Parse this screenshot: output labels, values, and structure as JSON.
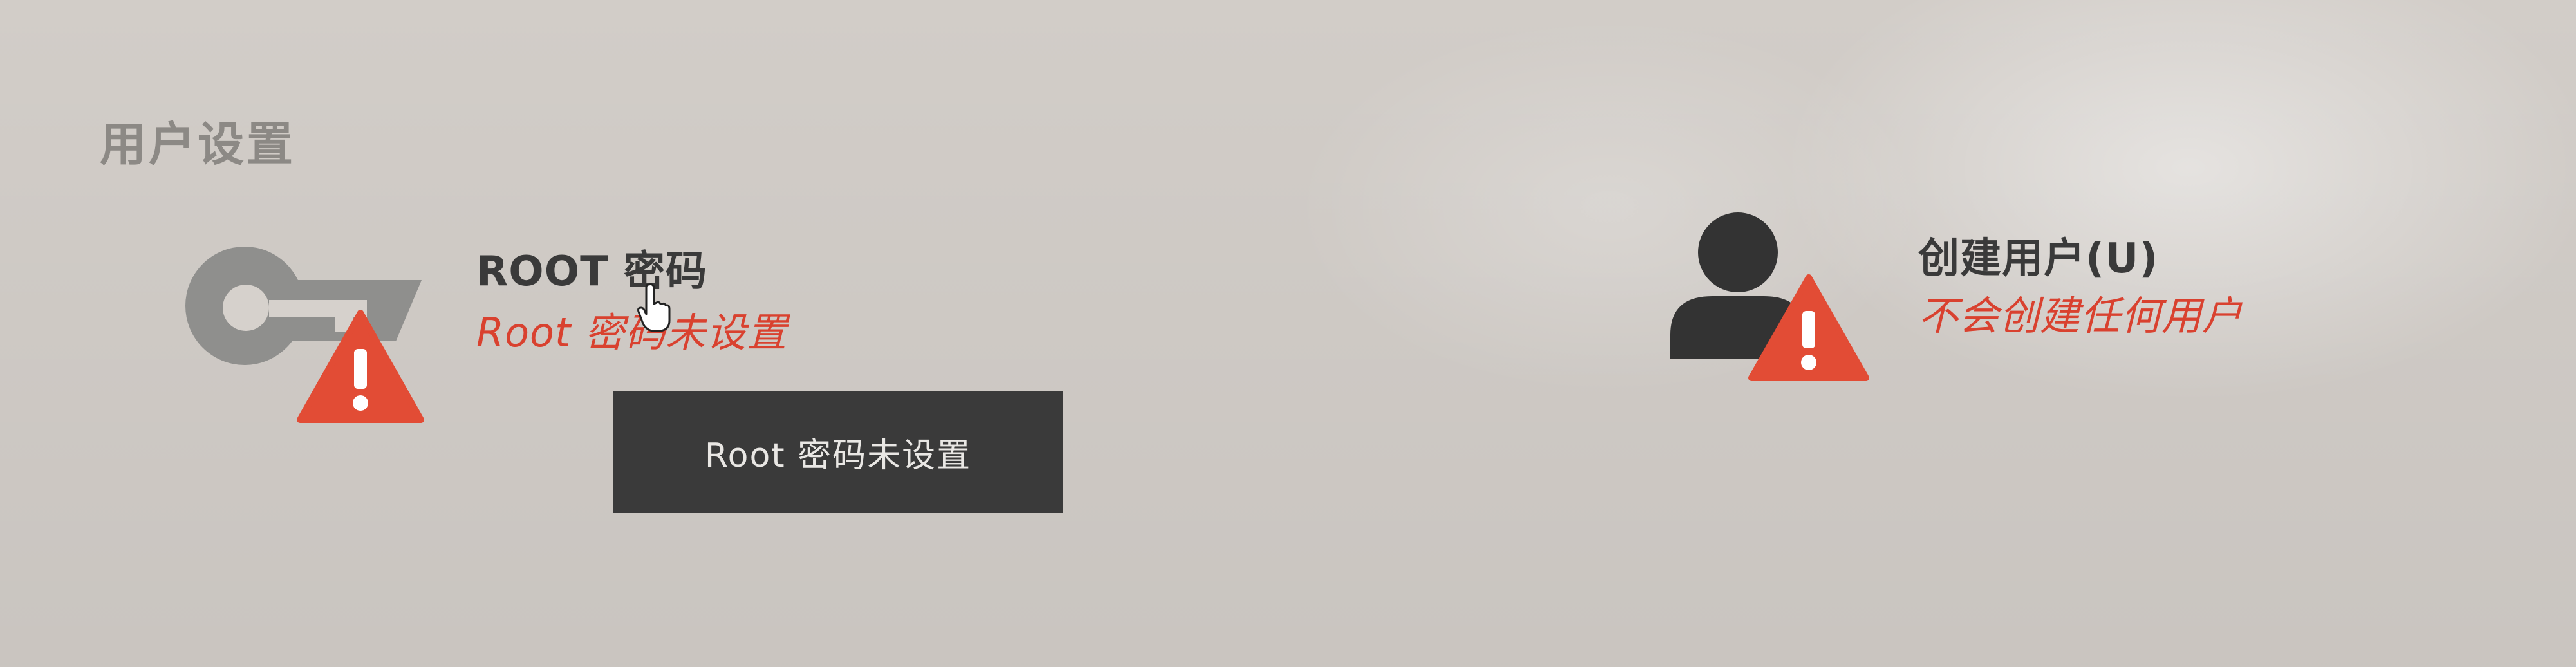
{
  "section": {
    "title": "用户设置"
  },
  "spokes": {
    "root": {
      "title": "ROOT 密码",
      "status": "Root 密码未设置",
      "icon": "key-icon",
      "warning_icon": "warning-icon"
    },
    "user": {
      "title": "创建用户(U)",
      "status": "不会创建任何用户",
      "icon": "user-icon",
      "warning_icon": "warning-icon"
    }
  },
  "tooltip": {
    "text": "Root 密码未设置"
  },
  "colors": {
    "background": "#d6d1cc",
    "section_title": "#8c8985",
    "spoke_title": "#3a3a3a",
    "warning_text": "#d9412f",
    "warning_triangle": "#e24c35",
    "icon_gray": "#8f8f8d",
    "icon_dark": "#333333",
    "tooltip_bg": "#3a3a3a",
    "tooltip_text": "#e9e7e4"
  }
}
